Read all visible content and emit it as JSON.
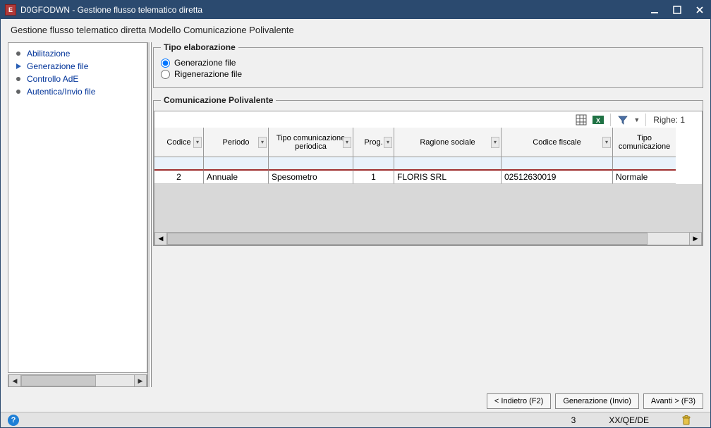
{
  "titlebar": {
    "app_code": "D0GFODWN",
    "title_suffix": "Gestione flusso telematico diretta",
    "full_title": "D0GFODWN - Gestione flusso telematico diretta"
  },
  "subtitle": "Gestione flusso telematico diretta Modello Comunicazione Polivalente",
  "sidebar": {
    "items": [
      {
        "label": "Abilitazione",
        "active": false
      },
      {
        "label": "Generazione file",
        "active": true
      },
      {
        "label": "Controllo AdE",
        "active": false
      },
      {
        "label": "Autentica/Invio file",
        "active": false
      }
    ]
  },
  "groups": {
    "tipo_elaborazione": {
      "legend": "Tipo elaborazione",
      "options": {
        "generazione_label": "Generazione file",
        "rigenerazione_label": "Rigenerazione file"
      },
      "selected": "generazione"
    },
    "comunicazione_polivalente": {
      "legend": "Comunicazione Polivalente"
    }
  },
  "toolbar": {
    "rows_label_prefix": "Righe:",
    "rows_count": "1"
  },
  "table": {
    "headers": {
      "codice": "Codice",
      "periodo": "Periodo",
      "tipo_com_periodica": "Tipo comunicazione periodica",
      "prog": "Prog.",
      "ragione_sociale": "Ragione sociale",
      "codice_fiscale": "Codice fiscale",
      "tipo_comunicazione": "Tipo comunicazione"
    },
    "rows": [
      {
        "codice": "2",
        "periodo": "Annuale",
        "tipo_com_periodica": "Spesometro",
        "prog": "1",
        "ragione_sociale": "FLORIS SRL",
        "codice_fiscale": "02512630019",
        "tipo_comunicazione": "Normale"
      }
    ]
  },
  "buttons": {
    "back": "< Indietro (F2)",
    "action": "Generazione (Invio)",
    "next": "Avanti > (F3)"
  },
  "status": {
    "num": "3",
    "code": "XX/QE/DE"
  }
}
